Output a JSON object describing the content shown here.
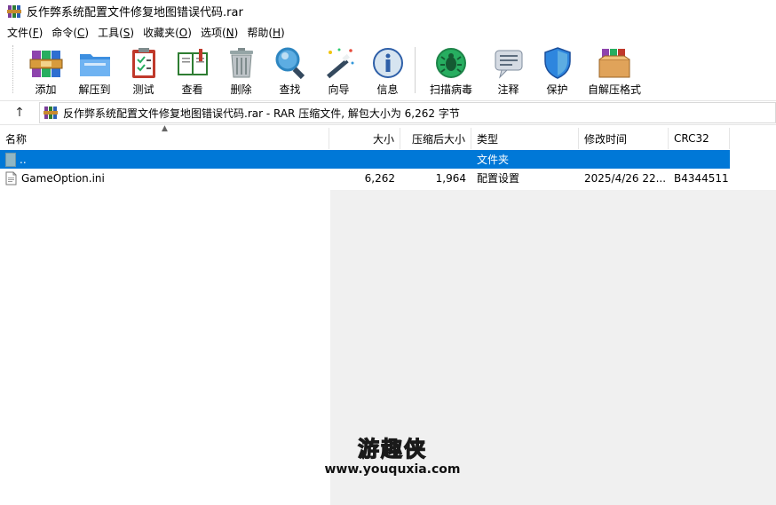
{
  "window": {
    "title": "反作弊系统配置文件修复地图错误代码.rar"
  },
  "menu": [
    {
      "label": "文件",
      "key": "F"
    },
    {
      "label": "命令",
      "key": "C"
    },
    {
      "label": "工具",
      "key": "S"
    },
    {
      "label": "收藏夹",
      "key": "O"
    },
    {
      "label": "选项",
      "key": "N"
    },
    {
      "label": "帮助",
      "key": "H"
    }
  ],
  "toolbar": {
    "add": "添加",
    "extract_to": "解压到",
    "test": "测试",
    "view": "查看",
    "delete": "删除",
    "find": "查找",
    "wizard": "向导",
    "info": "信息",
    "virus_scan": "扫描病毒",
    "comment": "注释",
    "protect": "保护",
    "sfx": "自解压格式"
  },
  "address": {
    "up_icon": "arrow-up-icon",
    "path": "反作弊系统配置文件修复地图错误代码.rar - RAR 压缩文件, 解包大小为 6,262 字节"
  },
  "columns": {
    "name": "名称",
    "size": "大小",
    "packed": "压缩后大小",
    "type": "类型",
    "modified": "修改时间",
    "crc": "CRC32"
  },
  "rows": [
    {
      "name": "..",
      "size": "",
      "packed": "",
      "type": "文件夹",
      "modified": "",
      "crc": "",
      "selected": true
    },
    {
      "name": "GameOption.ini",
      "size": "6,262",
      "packed": "1,964",
      "type": "配置设置",
      "modified": "2025/4/26 22...",
      "crc": "B4344511",
      "selected": false
    }
  ],
  "watermark": {
    "logo": "游趣侠",
    "url": "www.youquxia.com"
  },
  "colors": {
    "selection": "#0078d7",
    "watermark_yellow": "#f7c11a"
  }
}
